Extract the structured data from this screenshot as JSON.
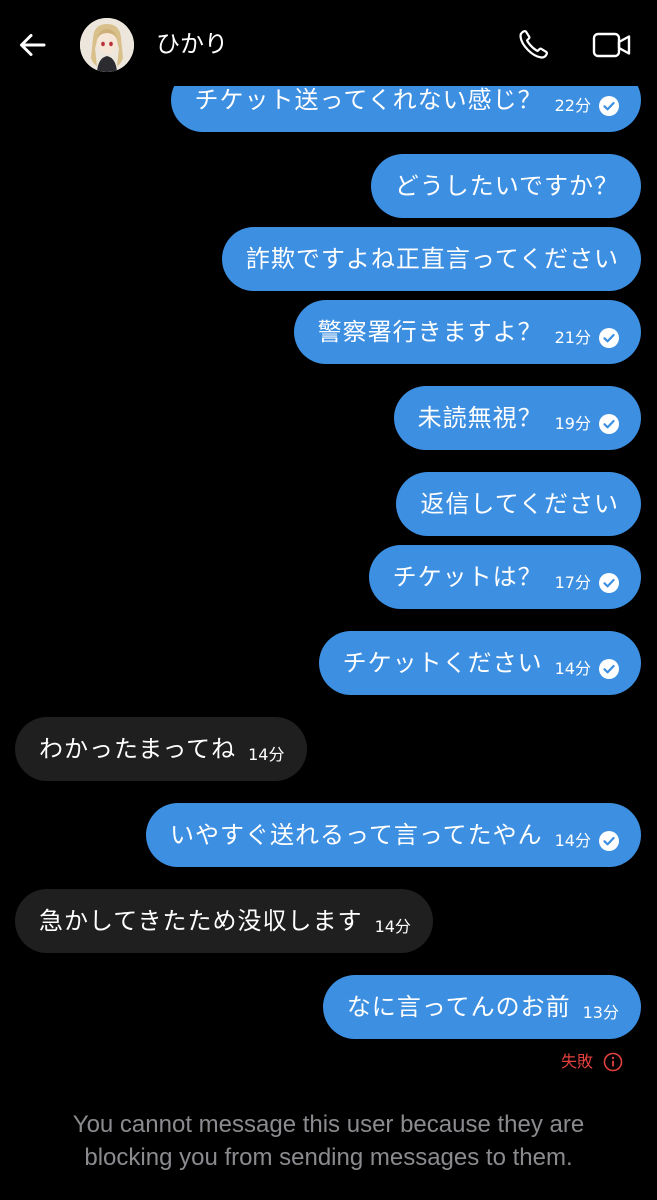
{
  "header": {
    "contact_name": "ひかり",
    "back_icon": "arrow-left-icon",
    "call_icon": "phone-icon",
    "video_icon": "video-camera-icon",
    "avatar": "contact-avatar-anime-girl"
  },
  "colors": {
    "outgoing_bubble": "#3d8fe2",
    "incoming_bubble": "#1f1f1f",
    "failed_red": "#e0413f",
    "notice_gray": "#8b8b8f"
  },
  "messages": [
    {
      "direction": "out",
      "text": "チケット送ってくれない感じ？",
      "time": "22分",
      "read": true
    },
    {
      "direction": "out",
      "text": "どうしたいですか？",
      "time": "",
      "read": false
    },
    {
      "direction": "out",
      "text": "詐欺ですよね正直言ってください",
      "time": "",
      "read": false
    },
    {
      "direction": "out",
      "text": "警察署行きますよ？",
      "time": "21分",
      "read": true
    },
    {
      "direction": "out",
      "text": "未読無視？",
      "time": "19分",
      "read": true
    },
    {
      "direction": "out",
      "text": "返信してください",
      "time": "",
      "read": false
    },
    {
      "direction": "out",
      "text": "チケットは？",
      "time": "17分",
      "read": true
    },
    {
      "direction": "out",
      "text": "チケットください",
      "time": "14分",
      "read": true
    },
    {
      "direction": "in",
      "text": "わかったまってね",
      "time": "14分",
      "read": false
    },
    {
      "direction": "out",
      "text": "いやすぐ送れるって言ってたやん",
      "time": "14分",
      "read": true
    },
    {
      "direction": "in",
      "text": "急かしてきたため没収します",
      "time": "14分",
      "read": false
    },
    {
      "direction": "out",
      "text": "なに言ってんのお前",
      "time": "13分",
      "read": false
    }
  ],
  "failed": {
    "label": "失敗",
    "icon": "info-circle-icon"
  },
  "blocked_notice": {
    "line1": "You cannot message this user because they are",
    "line2": "blocking you from sending messages to them."
  }
}
